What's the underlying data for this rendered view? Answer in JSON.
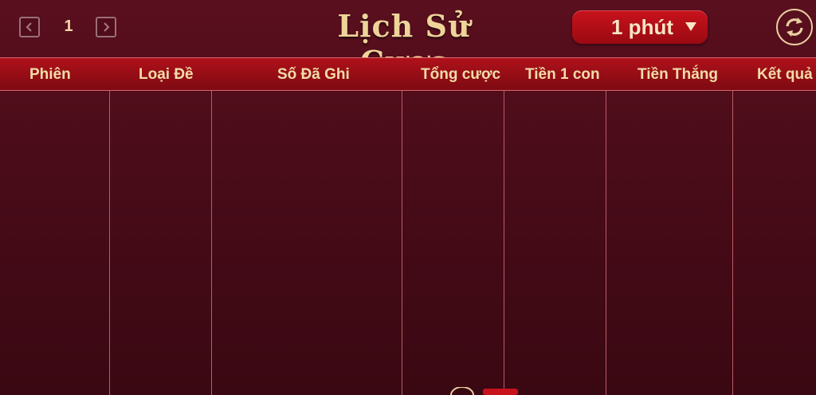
{
  "pagination": {
    "page": "1"
  },
  "title": "Lịch Sử Cược",
  "period_select": {
    "label": "1 phút"
  },
  "columns": [
    "Phiên",
    "Loại Đề",
    "Số Đã Ghi",
    "Tổng cược",
    "Tiền 1 con",
    "Tiền Thắng",
    "Kết quả"
  ],
  "colors": {
    "accent": "#b0111a",
    "text_gold": "#efd49a",
    "background": "#4a0c19"
  }
}
